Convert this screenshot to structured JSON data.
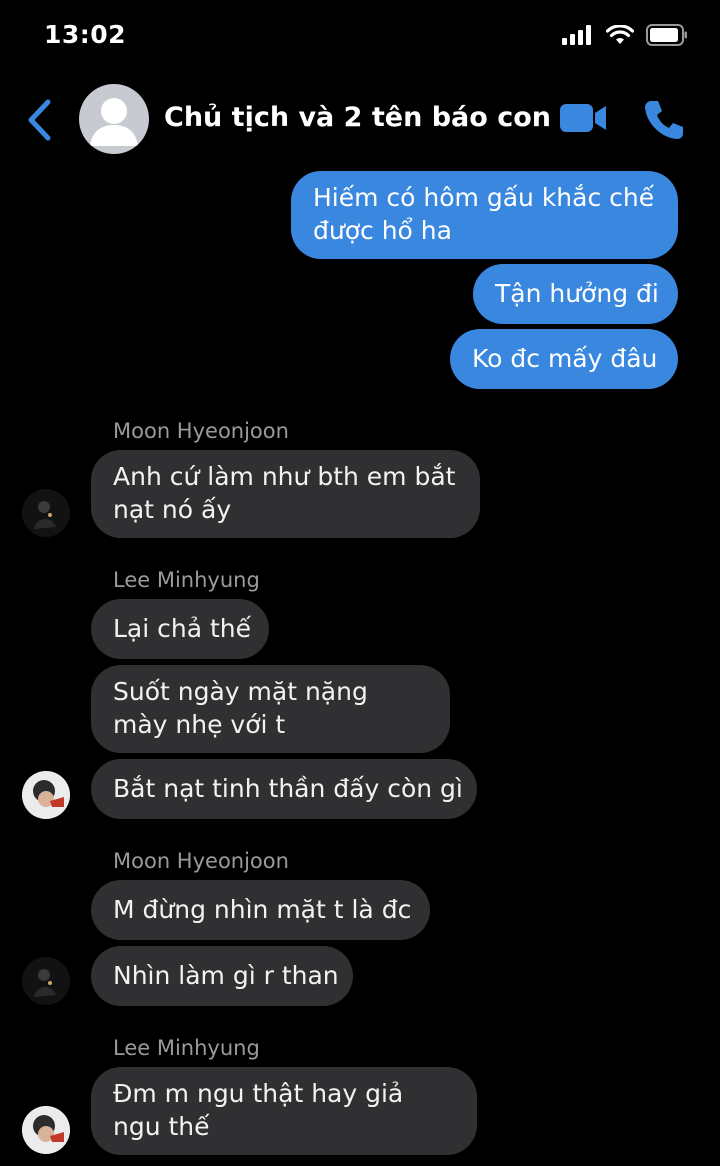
{
  "status_bar": {
    "time": "13:02"
  },
  "header": {
    "title": "Chủ tịch và 2 tên báo con",
    "accent": "#3a87e0"
  },
  "messages": [
    {
      "sender": "",
      "text": "Hiếm có hôm gấu khắc chế được hổ ha",
      "direction": "outgoing"
    },
    {
      "sender": "",
      "text": "Tận hưởng đi",
      "direction": "outgoing"
    },
    {
      "sender": "",
      "text": "Ko đc mấy đâu",
      "direction": "outgoing"
    },
    {
      "sender": "Moon Hyeonjoon",
      "text": "Anh cứ làm như bth em bắt nạt nó ấy",
      "direction": "incoming"
    },
    {
      "sender": "Lee Minhyung",
      "text": "Lại chả thế",
      "direction": "incoming"
    },
    {
      "sender": "",
      "text": "Suốt ngày mặt nặng mày nhẹ với t",
      "direction": "incoming"
    },
    {
      "sender": "",
      "text": "Bắt nạt tinh thần đấy còn gì",
      "direction": "incoming"
    },
    {
      "sender": "Moon Hyeonjoon",
      "text": "M đừng nhìn mặt t là đc",
      "direction": "incoming"
    },
    {
      "sender": "",
      "text": "Nhìn làm gì r than",
      "direction": "incoming"
    },
    {
      "sender": "Lee Minhyung",
      "text": "Đm m ngu thật hay giả ngu thế",
      "direction": "incoming"
    }
  ],
  "colors": {
    "outgoing_bubble": "#3a87e0",
    "incoming_bubble": "#303033",
    "background": "#000000"
  }
}
